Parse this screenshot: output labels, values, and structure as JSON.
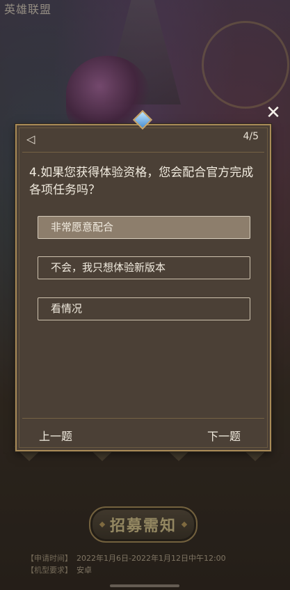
{
  "app": {
    "logo_text": "英雄联盟"
  },
  "dialog": {
    "progress": "4/5",
    "question": "4.如果您获得体验资格，您会配合官方完成各项任务吗？",
    "options": [
      {
        "label": "非常愿意配合",
        "selected": true
      },
      {
        "label": "不会，我只想体验新版本",
        "selected": false
      },
      {
        "label": "看情况",
        "selected": false
      }
    ],
    "prev_label": "上一题",
    "next_label": "下一题"
  },
  "page": {
    "recruit_button": "招募需知",
    "info": [
      {
        "key": "【申请时间】",
        "value": "2022年1月6日-2022年1月12日中午12:00"
      },
      {
        "key": "【机型要求】",
        "value": "安卓"
      }
    ]
  },
  "icons": {
    "close": "close-icon",
    "back": "back-arrow-icon",
    "gem": "diamond-gem-icon"
  }
}
